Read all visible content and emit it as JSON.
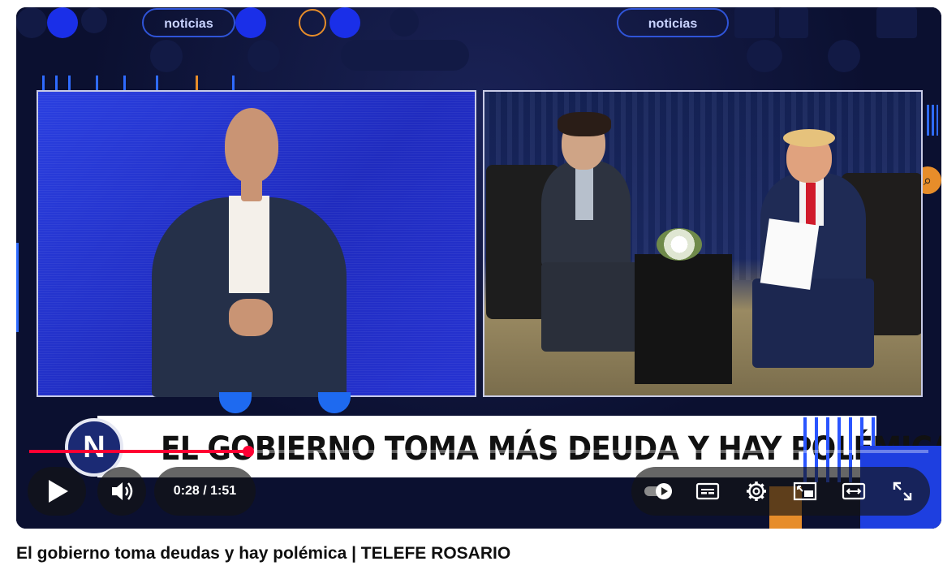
{
  "video": {
    "tag_left": "noticias",
    "tag_right": "noticias",
    "chyron_text": "EL GOBIERNO TOMA MÁS DEUDA Y HAY POLÉMICA",
    "logo_letter": "N",
    "progress_fraction": 0.244
  },
  "controls": {
    "time_display": "0:28 / 1:51",
    "play_icon": "play-icon",
    "volume_icon": "volume-icon",
    "autoplay_icon": "autoplay-toggle-icon",
    "subtitles_icon": "subtitles-icon",
    "settings_icon": "gear-icon",
    "miniplayer_icon": "miniplayer-icon",
    "theater_icon": "theater-mode-icon",
    "fullscreen_icon": "fullscreen-icon"
  },
  "page": {
    "video_title": "El gobierno toma deudas y hay polémica | TELEFE ROSARIO"
  }
}
